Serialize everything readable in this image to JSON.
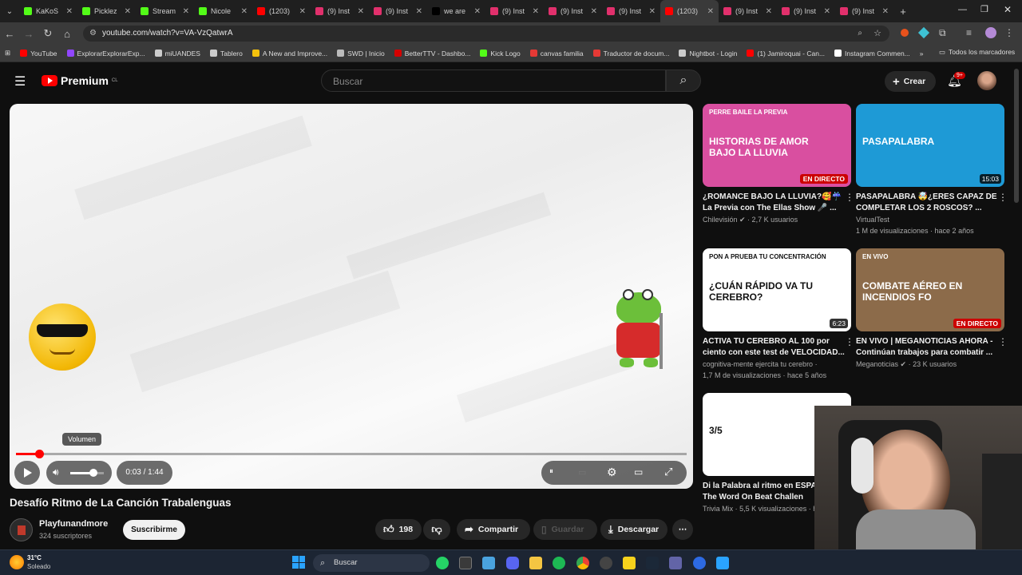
{
  "browser": {
    "tabs": [
      {
        "title": "KaKoS",
        "color": "#53fc18"
      },
      {
        "title": "Picklez",
        "color": "#53fc18"
      },
      {
        "title": "Stream",
        "color": "#53fc18"
      },
      {
        "title": "Nicole",
        "color": "#53fc18"
      },
      {
        "title": "(1203)",
        "color": "#ff0000"
      },
      {
        "title": "(9) Inst",
        "color": "#e1306c"
      },
      {
        "title": "(9) Inst",
        "color": "#e1306c"
      },
      {
        "title": "we are",
        "color": "#000000"
      },
      {
        "title": "(9) Inst",
        "color": "#e1306c"
      },
      {
        "title": "(9) Inst",
        "color": "#e1306c"
      },
      {
        "title": "(9) Inst",
        "color": "#e1306c"
      },
      {
        "title": "(1203)",
        "color": "#ff0000"
      },
      {
        "title": "(9) Inst",
        "color": "#e1306c"
      },
      {
        "title": "(9) Inst",
        "color": "#e1306c"
      },
      {
        "title": "(9) Inst",
        "color": "#e1306c"
      }
    ],
    "url": "youtube.com/watch?v=VA-VzQatwrA",
    "bookmarks": [
      {
        "label": "YouTube",
        "color": "#ff0000"
      },
      {
        "label": "ExplorarExplorarExp...",
        "color": "#9146ff"
      },
      {
        "label": "miUANDES",
        "color": "#cccccc"
      },
      {
        "label": "Tablero",
        "color": "#cccccc"
      },
      {
        "label": "A New and Improve...",
        "color": "#f4c20d"
      },
      {
        "label": "SWD | Inicio",
        "color": "#bbbbbb"
      },
      {
        "label": "BetterTTV - Dashbo...",
        "color": "#d50000"
      },
      {
        "label": "Kick Logo",
        "color": "#53fc18"
      },
      {
        "label": "canvas familia",
        "color": "#e53935"
      },
      {
        "label": "Traductor de docum...",
        "color": "#e53935"
      },
      {
        "label": "Nightbot - Login",
        "color": "#cccccc"
      },
      {
        "label": "(1) Jamiroquai - Can...",
        "color": "#ff0000"
      },
      {
        "label": "Instagram Commen...",
        "color": "#ffffff"
      }
    ],
    "all_bookmarks": "Todos los marcadores"
  },
  "youtube": {
    "logo": "Premium",
    "country": "CL",
    "search_placeholder": "Buscar",
    "create_label": "Crear",
    "notif_count": "9+"
  },
  "player": {
    "tooltip": "Volumen",
    "time": "0:03 / 1:44",
    "progress_fraction": 0.035,
    "volume_fraction": 0.7
  },
  "video": {
    "title": "Desafío Ritmo de La Canción Trabalenguas",
    "channel": "Playfunandmore",
    "subscribers": "324 suscriptores",
    "subscribe": "Suscribirme",
    "likes": "198",
    "share": "Compartir",
    "save": "Guardar",
    "download": "Descargar"
  },
  "recommendations": [
    {
      "title": "¿ROMANCE BAJO LA LLUVIA?🥰☔ La Previa con The Ellas Show 🎤 ...",
      "meta1": "Chilevisión ✔ · 2,7 K usuarios",
      "meta2": "",
      "badge": "EN DIRECTO",
      "badge_type": "live",
      "thumb_text": "HISTORIAS DE AMOR BAJO LA LLUVIA",
      "thumb_top": "PERRE BAILE LA PREVIA",
      "bg": "#d94fa0"
    },
    {
      "title": "PASAPALABRA 🤯¿ERES CAPAZ DE COMPLETAR LOS 2 ROSCOS? ...",
      "meta1": "VirtualTest",
      "meta2": "1 M de visualizaciones · hace 2 años",
      "badge": "15:03",
      "badge_type": "dur",
      "thumb_text": "PASAPALABRA",
      "thumb_top": "",
      "bg": "#1e9ad6"
    },
    {
      "title": "ACTIVA TU CEREBRO AL 100 por ciento con este test de VELOCIDAD...",
      "meta1": "cognitiva-mente ejercita tu cerebro ·",
      "meta2": "1,7 M de visualizaciones · hace 5 años",
      "badge": "6:23",
      "badge_type": "dur",
      "thumb_text": "¿CUÁN RÁPIDO VA TU CEREBRO?",
      "thumb_top": "PON A PRUEBA TU CONCENTRACIÓN",
      "bg": "#ffffff"
    },
    {
      "title": "EN VIVO | MEGANOTICIAS AHORA - Continúan trabajos para combatir ...",
      "meta1": "Meganoticias ✔ · 23 K usuarios",
      "meta2": "",
      "badge": "EN DIRECTO",
      "badge_type": "live",
      "thumb_text": "COMBATE AÉREO EN INCENDIOS FO",
      "thumb_top": "EN VIVO",
      "bg": "#8c6b4a"
    },
    {
      "title": "Di la Palabra al ritmo en ESPAÑ (Say The Word On Beat Challen",
      "meta1": "Trivia Mix · 5,5 K visualizaciones · h",
      "meta2": "",
      "badge": "",
      "badge_type": "",
      "thumb_text": "3/5",
      "thumb_top": "",
      "bg": "#ffffff"
    }
  ],
  "taskbar": {
    "temp": "31°C",
    "weather": "Soleado",
    "search": "Buscar"
  }
}
